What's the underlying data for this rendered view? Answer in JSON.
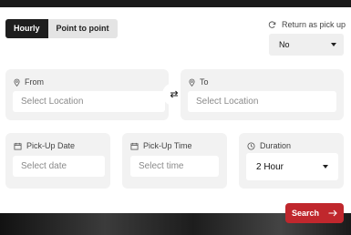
{
  "tabs": [
    {
      "label": "Hourly",
      "active": true
    },
    {
      "label": "Point to point",
      "active": false
    }
  ],
  "return_pickup": {
    "label": "Return as pick up",
    "value": "No"
  },
  "from": {
    "label": "From",
    "placeholder": "Select Location"
  },
  "to": {
    "label": "To",
    "placeholder": "Select Location"
  },
  "pickup_date": {
    "label": "Pick-Up Date",
    "placeholder": "Select date"
  },
  "pickup_time": {
    "label": "Pick-Up Time",
    "placeholder": "Select time"
  },
  "duration": {
    "label": "Duration",
    "value": "2 Hour"
  },
  "search_button": {
    "label": "Search"
  },
  "colors": {
    "accent": "#c0272d",
    "active_tab": "#1e1e1e"
  },
  "icons": {
    "return": "refresh-icon",
    "location": "location-pin-icon",
    "swap": "swap-arrows-icon",
    "calendar": "calendar-icon",
    "clock": "clock-icon",
    "search": "arrow-right-icon"
  }
}
